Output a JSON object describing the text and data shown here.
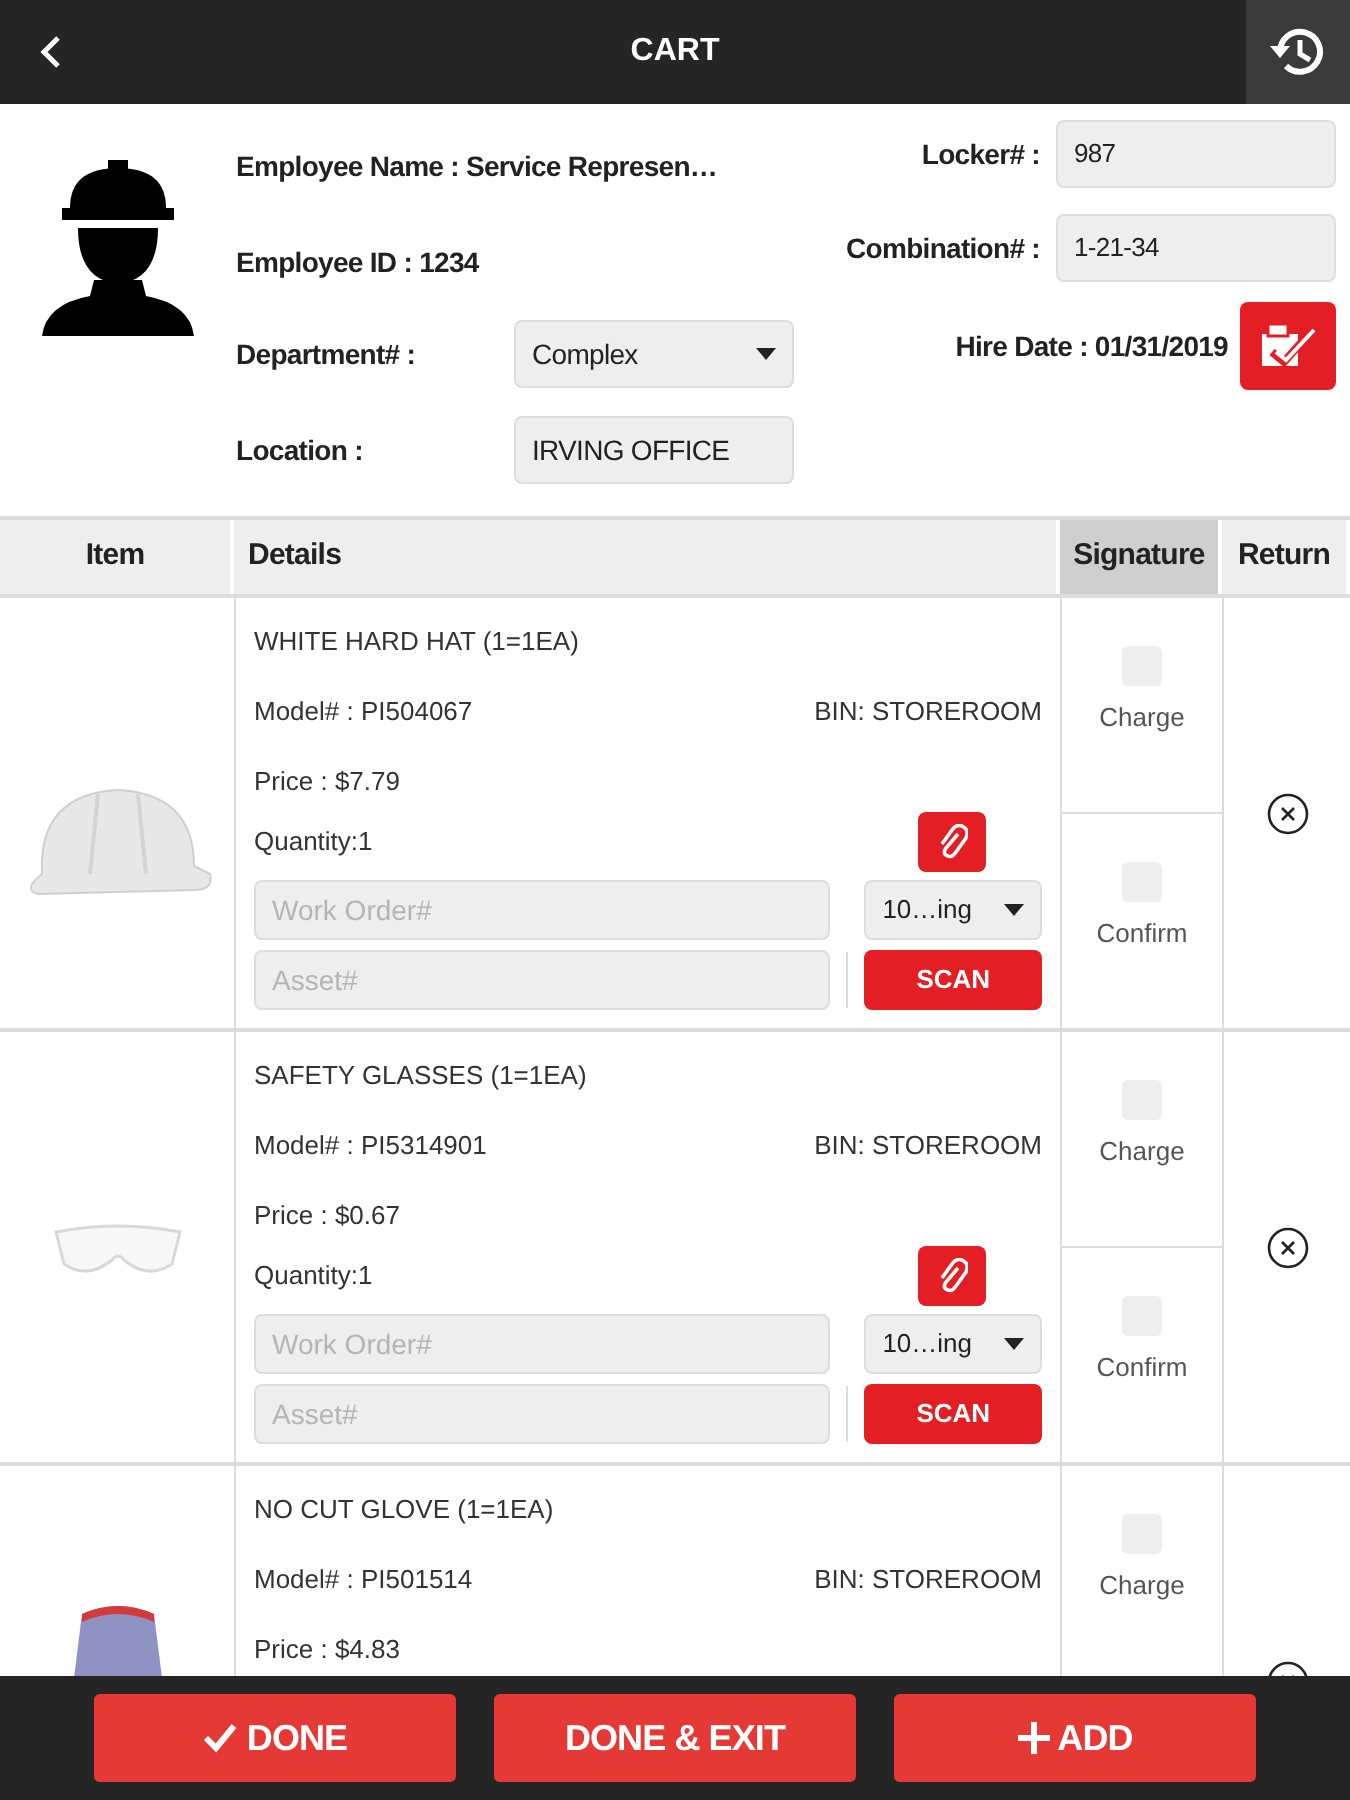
{
  "header": {
    "title": "CART"
  },
  "employee": {
    "name": "Employee Name : Service Represen…",
    "id": "Employee ID : 1234",
    "department_label": "Department# :",
    "department_value": "Complex",
    "location_label": "Location :",
    "location_value": "IRVING OFFICE",
    "locker_label": "Locker# :",
    "locker_value": "987",
    "combination_label": "Combination# :",
    "combination_value": "1-21-34",
    "hire_date": "Hire Date : 01/31/2019"
  },
  "table": {
    "columns": [
      {
        "label": "Item",
        "selected": false
      },
      {
        "label": "Details",
        "selected": false
      },
      {
        "label": "Signature",
        "selected": true
      },
      {
        "label": "Return",
        "selected": false
      }
    ],
    "rows": [
      {
        "kind": "hard-hat",
        "title": "WHITE HARD HAT (1=1EA)",
        "model": "Model# : PI504067",
        "bin": "BIN: STOREROOM",
        "price": "Price : $7.79",
        "quantity": "Quantity:1",
        "work_order": {
          "placeholder": "Work Order#"
        },
        "asset": {
          "placeholder": "Asset#"
        },
        "dropdown": "10…ing",
        "scan": "SCAN",
        "signature": [
          {
            "label": "Charge",
            "checked": false
          },
          {
            "label": "Confirm",
            "checked": false
          }
        ]
      },
      {
        "kind": "glasses",
        "title": "SAFETY GLASSES (1=1EA)",
        "model": "Model# : PI5314901",
        "bin": "BIN: STOREROOM",
        "price": "Price : $0.67",
        "quantity": "Quantity:1",
        "work_order": {
          "placeholder": "Work Order#"
        },
        "asset": {
          "placeholder": "Asset#"
        },
        "dropdown": "10…ing",
        "scan": "SCAN",
        "signature": [
          {
            "label": "Charge",
            "checked": false
          },
          {
            "label": "Confirm",
            "checked": false
          }
        ]
      },
      {
        "kind": "glove",
        "title": "NO CUT GLOVE (1=1EA)",
        "model": "Model# : PI501514",
        "bin": "BIN: STOREROOM",
        "price": "Price : $4.83",
        "signature": [
          {
            "label": "Charge",
            "checked": false
          }
        ]
      }
    ]
  },
  "footer": {
    "buttons": [
      {
        "label": "DONE"
      },
      {
        "label": "DONE & EXIT"
      },
      {
        "label": "ADD"
      }
    ]
  }
}
